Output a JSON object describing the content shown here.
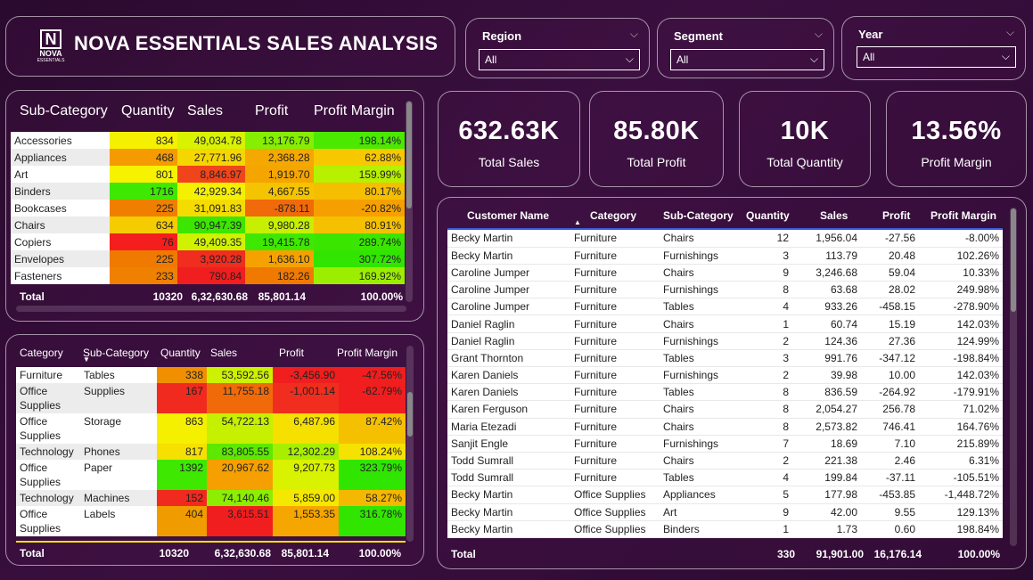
{
  "brand": {
    "logo_letter": "N",
    "logo_name": "NOVA",
    "logo_sub": "ESSENTIALS",
    "title": "NOVA ESSENTIALS SALES ANALYSIS"
  },
  "slicers": [
    {
      "label": "Region",
      "value": "All"
    },
    {
      "label": "Segment",
      "value": "All"
    },
    {
      "label": "Year",
      "value": "All"
    }
  ],
  "kpis": [
    {
      "value": "632.63K",
      "label": "Total Sales"
    },
    {
      "value": "85.80K",
      "label": "Total Profit"
    },
    {
      "value": "10K",
      "label": "Total Quantity"
    },
    {
      "value": "13.56%",
      "label": "Profit Margin"
    }
  ],
  "subcat_table": {
    "headers": [
      "Sub-Category",
      "Quantity",
      "Sales",
      "Profit",
      "Profit Margin"
    ],
    "rows": [
      {
        "c": [
          "Accessories",
          "834",
          "49,034.78",
          "13,176.79",
          "198.14%"
        ],
        "bg": [
          "#fff",
          "#f5f000",
          "#d8f200",
          "#86ee00",
          "#4be800"
        ]
      },
      {
        "c": [
          "Appliances",
          "468",
          "27,771.96",
          "2,368.28",
          "62.88%"
        ],
        "bg": [
          "#ececec",
          "#f59a00",
          "#f5d600",
          "#f5a800",
          "#f7c800"
        ]
      },
      {
        "c": [
          "Art",
          "801",
          "8,846.97",
          "1,919.70",
          "159.99%"
        ],
        "bg": [
          "#fff",
          "#f7f200",
          "#f0451b",
          "#f5a500",
          "#b7f000"
        ]
      },
      {
        "c": [
          "Binders",
          "1716",
          "42,929.34",
          "4,667.55",
          "80.17%"
        ],
        "bg": [
          "#ececec",
          "#3ee800",
          "#f5f000",
          "#f5c400",
          "#f5be00"
        ]
      },
      {
        "c": [
          "Bookcases",
          "225",
          "31,091.83",
          "-878.11",
          "-20.82%"
        ],
        "bg": [
          "#fff",
          "#f07f00",
          "#f5dc00",
          "#f06a0a",
          "#f5a000"
        ]
      },
      {
        "c": [
          "Chairs",
          "634",
          "90,947.39",
          "9,980.28",
          "80.91%"
        ],
        "bg": [
          "#ececec",
          "#f5cc00",
          "#3de600",
          "#c6f000",
          "#f5c000"
        ]
      },
      {
        "c": [
          "Copiers",
          "76",
          "49,409.35",
          "19,415.78",
          "289.74%"
        ],
        "bg": [
          "#fff",
          "#f51e1e",
          "#d0f200",
          "#3fe800",
          "#3ae600"
        ]
      },
      {
        "c": [
          "Envelopes",
          "225",
          "3,920.28",
          "1,636.10",
          "307.72%"
        ],
        "bg": [
          "#ececec",
          "#f07a00",
          "#f02d1e",
          "#f5a200",
          "#32e500"
        ]
      },
      {
        "c": [
          "Fasteners",
          "233",
          "790.84",
          "182.26",
          "169.92%"
        ],
        "bg": [
          "#fff",
          "#f08000",
          "#f01e1e",
          "#f07a00",
          "#9cee00"
        ]
      }
    ],
    "total": [
      "Total",
      "10320",
      "6,32,630.68",
      "85,801.14",
      "100.00%"
    ]
  },
  "cat_table": {
    "headers": [
      "Category",
      "Sub-Category",
      "Quantity",
      "Sales",
      "Profit",
      "Profit Margin"
    ],
    "rows": [
      {
        "c": [
          "Furniture",
          "Tables",
          "338",
          "53,592.56",
          "-3,456.90",
          "-47.56%"
        ],
        "bg": [
          "#fff",
          "#fff",
          "#f09000",
          "#cdf200",
          "#f01e1e",
          "#f01e1e"
        ]
      },
      {
        "c": [
          "Office Supplies",
          "Supplies",
          "167",
          "11,755.18",
          "-1,001.14",
          "-62.79%"
        ],
        "bg": [
          "#ececec",
          "#ececec",
          "#f02a1e",
          "#f06a0a",
          "#f02d1e",
          "#f01e1e"
        ]
      },
      {
        "c": [
          "Office Supplies",
          "Storage",
          "863",
          "54,722.13",
          "6,487.96",
          "87.42%"
        ],
        "bg": [
          "#fff",
          "#fff",
          "#f5f000",
          "#c5f000",
          "#f5e000",
          "#f5c000"
        ]
      },
      {
        "c": [
          "Technology",
          "Phones",
          "817",
          "83,805.55",
          "12,302.29",
          "108.24%"
        ],
        "bg": [
          "#ececec",
          "#ececec",
          "#f5e000",
          "#5de800",
          "#a8ee00",
          "#f5e200"
        ]
      },
      {
        "c": [
          "Office Supplies",
          "Paper",
          "1392",
          "20,967.62",
          "9,207.73",
          "323.79%"
        ],
        "bg": [
          "#fff",
          "#fff",
          "#3ee800",
          "#f5a000",
          "#d8f200",
          "#30e500"
        ]
      },
      {
        "c": [
          "Technology",
          "Machines",
          "152",
          "74,140.46",
          "5,859.00",
          "58.27%"
        ],
        "bg": [
          "#ececec",
          "#ececec",
          "#f02a1e",
          "#8cee00",
          "#f5e800",
          "#f5b800"
        ]
      },
      {
        "c": [
          "Office Supplies",
          "Labels",
          "404",
          "3,615.51",
          "1,553.35",
          "316.78%"
        ],
        "bg": [
          "#fff",
          "#fff",
          "#f09c00",
          "#f01e1e",
          "#f5a600",
          "#32e500"
        ]
      }
    ],
    "total": [
      "Total",
      "10320",
      "6,32,630.68",
      "85,801.14",
      "100.00%"
    ]
  },
  "cust_table": {
    "headers": [
      "Customer Name",
      "Category",
      "Sub-Category",
      "Quantity",
      "Sales",
      "Profit",
      "Profit Margin"
    ],
    "rows": [
      [
        "Becky Martin",
        "Furniture",
        "Chairs",
        "12",
        "1,956.04",
        "-27.56",
        "-8.00%"
      ],
      [
        "Becky Martin",
        "Furniture",
        "Furnishings",
        "3",
        "113.79",
        "20.48",
        "102.26%"
      ],
      [
        "Caroline Jumper",
        "Furniture",
        "Chairs",
        "9",
        "3,246.68",
        "59.04",
        "10.33%"
      ],
      [
        "Caroline Jumper",
        "Furniture",
        "Furnishings",
        "8",
        "63.68",
        "28.02",
        "249.98%"
      ],
      [
        "Caroline Jumper",
        "Furniture",
        "Tables",
        "4",
        "933.26",
        "-458.15",
        "-278.90%"
      ],
      [
        "Daniel Raglin",
        "Furniture",
        "Chairs",
        "1",
        "60.74",
        "15.19",
        "142.03%"
      ],
      [
        "Daniel Raglin",
        "Furniture",
        "Furnishings",
        "2",
        "124.36",
        "27.36",
        "124.99%"
      ],
      [
        "Grant Thornton",
        "Furniture",
        "Tables",
        "3",
        "991.76",
        "-347.12",
        "-198.84%"
      ],
      [
        "Karen Daniels",
        "Furniture",
        "Furnishings",
        "2",
        "39.98",
        "10.00",
        "142.03%"
      ],
      [
        "Karen Daniels",
        "Furniture",
        "Tables",
        "8",
        "836.59",
        "-264.92",
        "-179.91%"
      ],
      [
        "Karen Ferguson",
        "Furniture",
        "Chairs",
        "8",
        "2,054.27",
        "256.78",
        "71.02%"
      ],
      [
        "Maria Etezadi",
        "Furniture",
        "Chairs",
        "8",
        "2,573.82",
        "746.41",
        "164.76%"
      ],
      [
        "Sanjit Engle",
        "Furniture",
        "Furnishings",
        "7",
        "18.69",
        "7.10",
        "215.89%"
      ],
      [
        "Todd Sumrall",
        "Furniture",
        "Chairs",
        "2",
        "221.38",
        "2.46",
        "6.31%"
      ],
      [
        "Todd Sumrall",
        "Furniture",
        "Tables",
        "4",
        "199.84",
        "-37.11",
        "-105.51%"
      ],
      [
        "Becky Martin",
        "Office Supplies",
        "Appliances",
        "5",
        "177.98",
        "-453.85",
        "-1,448.72%"
      ],
      [
        "Becky Martin",
        "Office Supplies",
        "Art",
        "9",
        "42.00",
        "9.55",
        "129.13%"
      ],
      [
        "Becky Martin",
        "Office Supplies",
        "Binders",
        "1",
        "1.73",
        "0.60",
        "198.84%"
      ]
    ],
    "total": [
      "Total",
      "330",
      "91,901.00",
      "16,176.14",
      "100.00%"
    ]
  },
  "icons": {
    "dropdown": "chevron-down-icon",
    "sort": "sort-caret-icon"
  }
}
